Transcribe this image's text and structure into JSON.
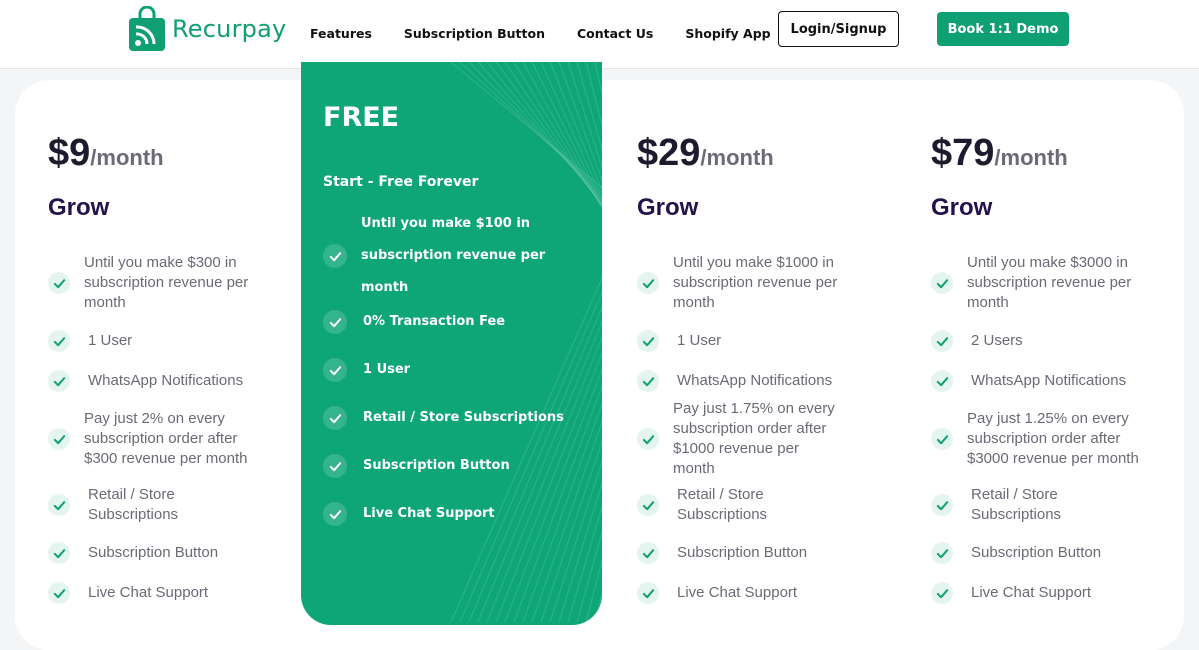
{
  "header": {
    "logo_text": "Recurpay",
    "nav": [
      "Features",
      "Subscription Button",
      "Contact Us",
      "Shopify App"
    ],
    "login_label": "Login/Signup",
    "demo_label": "Book 1:1 Demo",
    "brand_color": "#0e9f73"
  },
  "plans": [
    {
      "price": "$9",
      "period": "/month",
      "name": "Grow",
      "features": [
        "Until you make $300 in subscription revenue per month",
        "1 User",
        "WhatsApp Notifications",
        "Pay just 2% on every subscription order after $300 revenue per month",
        "Retail / Store Subscriptions",
        "Subscription Button",
        "Live Chat Support"
      ]
    },
    {
      "price": "$29",
      "period": "/month",
      "name": "Grow",
      "features": [
        "Until you make $1000 in subscription revenue per month",
        "1 User",
        "WhatsApp Notifications",
        "Pay just 1.75% on every subscription order after $1000 revenue per month",
        "Retail / Store Subscriptions",
        "Subscription Button",
        "Live Chat Support"
      ]
    },
    {
      "price": "$79",
      "period": "/month",
      "name": "Grow",
      "features": [
        "Until you make $3000 in subscription revenue per month",
        "2 Users",
        "WhatsApp Notifications",
        "Pay just 1.25% on every subscription order after $3000 revenue per month",
        "Retail / Store Subscriptions",
        "Subscription Button",
        "Live Chat Support"
      ]
    }
  ],
  "free_plan": {
    "title": "FREE",
    "subtitle": "Start - Free Forever",
    "features": [
      "Until you make $100 in subscription revenue per month",
      "0% Transaction Fee",
      "1 User",
      "Retail / Store Subscriptions",
      "Subscription Button",
      "Live Chat Support"
    ]
  },
  "icons": {
    "logo": "shopping-bag-rss-icon",
    "feature": "check-icon"
  }
}
